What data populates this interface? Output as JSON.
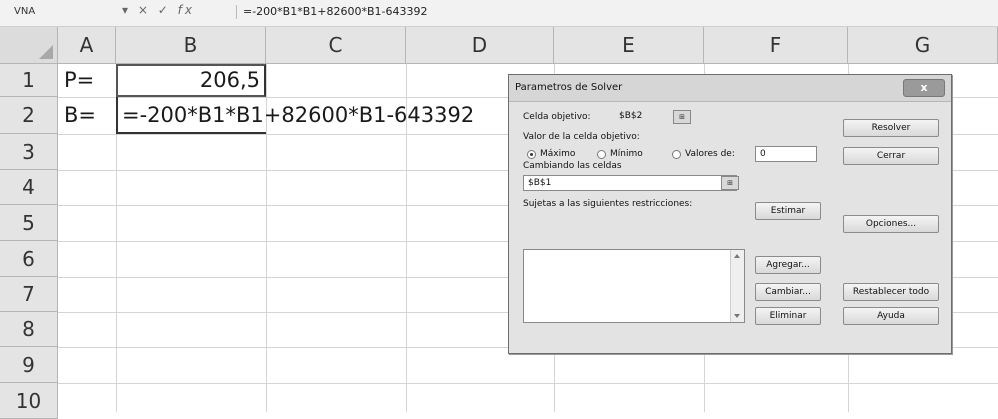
{
  "formula_bar": {
    "name_box": "VNA",
    "cancel_icon": "×",
    "confirm_icon": "✓",
    "fx_icon": "fx",
    "formula": "=-200*B1*B1+82600*B1-643392"
  },
  "columns": [
    "A",
    "B",
    "C",
    "D",
    "E",
    "F",
    "G"
  ],
  "rows": [
    "1",
    "2",
    "3",
    "4",
    "5",
    "6",
    "7",
    "8",
    "9",
    "10"
  ],
  "cells": {
    "A1": "P=",
    "B1": "206,5",
    "A2": "B=",
    "B2": "=-200*B1*B1+82600*B1-643392"
  },
  "solver": {
    "title": "Parametros de Solver",
    "close": "x",
    "objective_label": "Celda objetivo:",
    "objective_value": "$B$2",
    "value_label": "Valor de la celda objetivo:",
    "opt_max": "Máximo",
    "opt_min": "Mínimo",
    "opt_values": "Valores de:",
    "values_of": "0",
    "changing_label": "Cambiando las celdas",
    "changing_value": "$B$1",
    "constraints_label": "Sujetas a las siguientes restricciones:",
    "btn_solve": "Resolver",
    "btn_close": "Cerrar",
    "btn_guess": "Estimar",
    "btn_options": "Opciones...",
    "btn_add": "Agregar...",
    "btn_change": "Cambiar...",
    "btn_delete": "Eliminar",
    "btn_reset": "Restablecer todo",
    "btn_help": "Ayuda",
    "ref_icon": "⊞"
  }
}
